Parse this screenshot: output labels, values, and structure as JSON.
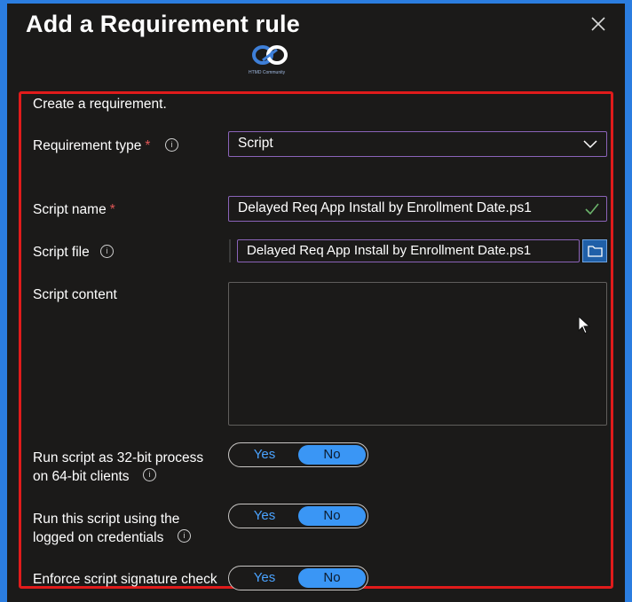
{
  "dialog": {
    "title": "Add a Requirement rule",
    "close_icon": "close-icon",
    "logo_text": "HTMD Community"
  },
  "form": {
    "intro": "Create a requirement.",
    "requirement_type": {
      "label": "Requirement type",
      "required_marker": "*",
      "value": "Script"
    },
    "script_name": {
      "label": "Script name",
      "required_marker": "*",
      "value": "Delayed Req App Install by Enrollment Date.ps1"
    },
    "script_file": {
      "label": "Script file",
      "value": "Delayed Req App Install by Enrollment Date.ps1"
    },
    "script_content": {
      "label": "Script content",
      "value": ""
    },
    "run_32bit": {
      "label_line1": "Run script as 32-bit process",
      "label_line2": "on 64-bit clients",
      "yes": "Yes",
      "no": "No",
      "selected": "No"
    },
    "logged_on": {
      "label_line1": "Run this script using the",
      "label_line2": "logged on credentials",
      "yes": "Yes",
      "no": "No",
      "selected": "No"
    },
    "signature_check": {
      "label": "Enforce script signature check",
      "yes": "Yes",
      "no": "No",
      "selected": "No"
    }
  },
  "colors": {
    "accent": "#3a96f5",
    "highlight_border": "#e01b1b",
    "valid_check": "#6bb36b",
    "field_border": "#8a63b8"
  }
}
